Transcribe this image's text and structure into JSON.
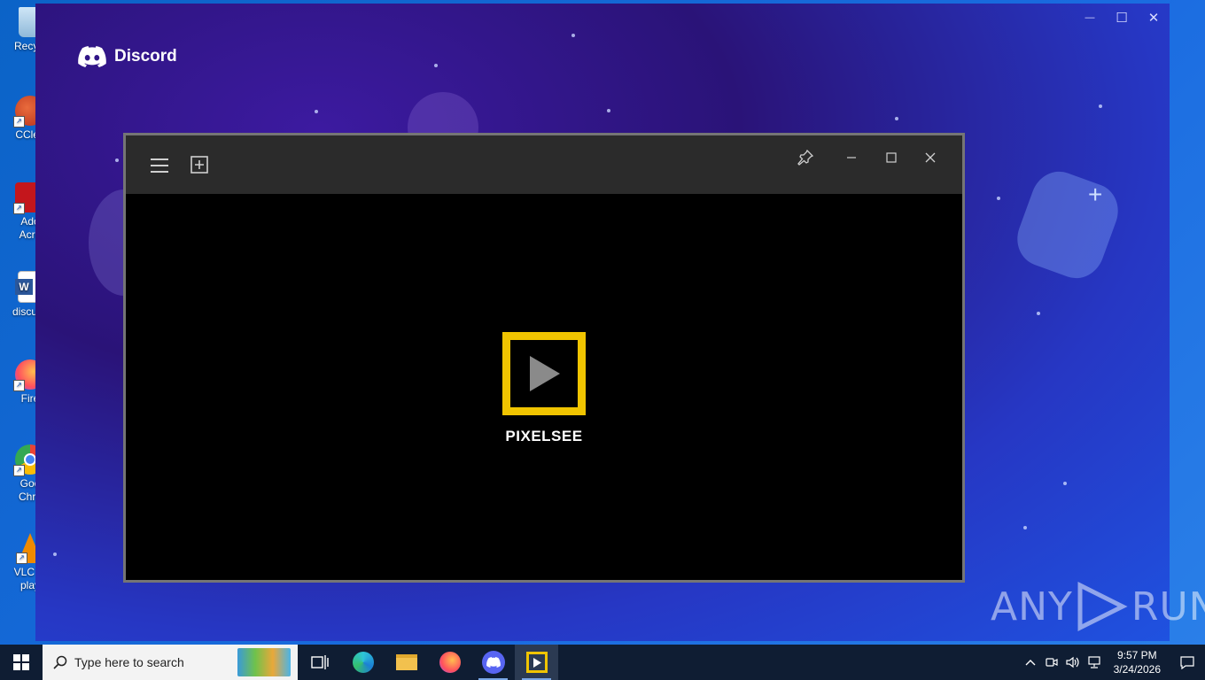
{
  "desktop": {
    "icons": [
      {
        "label": "Recycle Bin",
        "short": "Recycl",
        "color": "#9ac7e8"
      },
      {
        "label": "CCleaner",
        "short": "CClea",
        "color": "#d84a2a"
      },
      {
        "label": "Adobe Acrobat",
        "short": "Ado",
        "short2": "Acro",
        "color": "#c4161c"
      },
      {
        "label": "discuss",
        "short": "discuss",
        "color": "#2b579a"
      },
      {
        "label": "Firefox",
        "short": "Fire",
        "color": "#ff7139"
      },
      {
        "label": "Google Chrome",
        "short": "Goo",
        "short2": "Chro",
        "color": "#34a853"
      },
      {
        "label": "VLC media player",
        "short": "VLC m",
        "short2": "play",
        "color": "#f08a00"
      }
    ]
  },
  "discord": {
    "brand": "Discord",
    "window_controls": {
      "minimize": "—",
      "maximize": "☐",
      "close": "✕"
    }
  },
  "player": {
    "app_name": "PIXELSEE",
    "accent_color": "#f0c400",
    "titlebar_buttons": {
      "menu": "menu-icon",
      "add": "add-media-icon",
      "pin": "pin-icon",
      "minimize": "minimize-icon",
      "maximize": "maximize-icon",
      "close": "close-icon"
    }
  },
  "watermark": {
    "left": "ANY",
    "right": "RUN"
  },
  "taskbar": {
    "search_placeholder": "Type here to search",
    "apps": [
      "task-view",
      "edge",
      "file-explorer",
      "firefox",
      "discord",
      "pixelsee"
    ],
    "clock_time": "9:57 PM",
    "clock_date": "3/24/2026"
  }
}
